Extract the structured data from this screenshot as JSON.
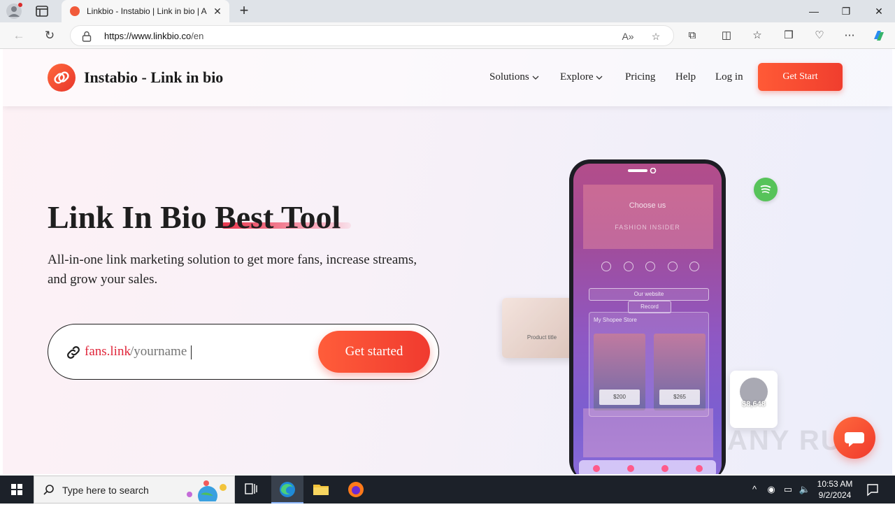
{
  "browser": {
    "tab_title": "Linkbio - Instabio | Link in bio | A",
    "tab_close": "✕",
    "new_tab": "+",
    "url_host": "https://www.linkbio.co",
    "url_path": "/en",
    "window_controls": {
      "minimize": "—",
      "maximize": "❐",
      "close": "✕"
    }
  },
  "site": {
    "brand": "Instabio - Link in bio",
    "nav": [
      {
        "label": "Solutions",
        "has_dropdown": true
      },
      {
        "label": "Explore",
        "has_dropdown": true
      },
      {
        "label": "Pricing",
        "has_dropdown": false
      },
      {
        "label": "Help",
        "has_dropdown": false
      },
      {
        "label": "Log in",
        "has_dropdown": false
      }
    ],
    "cta_top": "Get Start"
  },
  "hero": {
    "title": "Link In Bio Best Tool",
    "subtitle": "All-in-one link marketing solution to get more fans, increase streams, and grow your sales.",
    "link_prefix": "fans.link",
    "link_slug_placeholder": "/yourname",
    "get_started": "Get started"
  },
  "phone_preview": {
    "choose_us": "Choose us",
    "brand_line": "FASHION INSIDER",
    "our_website": "Our website",
    "record": "Record",
    "store_title": "My Shopee Store",
    "price_1": "$200",
    "price_2": "$265",
    "product_title": "Product title",
    "money_amount": "$8,648"
  },
  "watermark": "ANY RUN",
  "taskbar": {
    "search_placeholder": "Type here to search",
    "time": "10:53 AM",
    "date": "9/2/2024"
  },
  "colors": {
    "accent": "#f0402f",
    "accent_link": "#e0263b",
    "taskbar": "#1c2129"
  }
}
